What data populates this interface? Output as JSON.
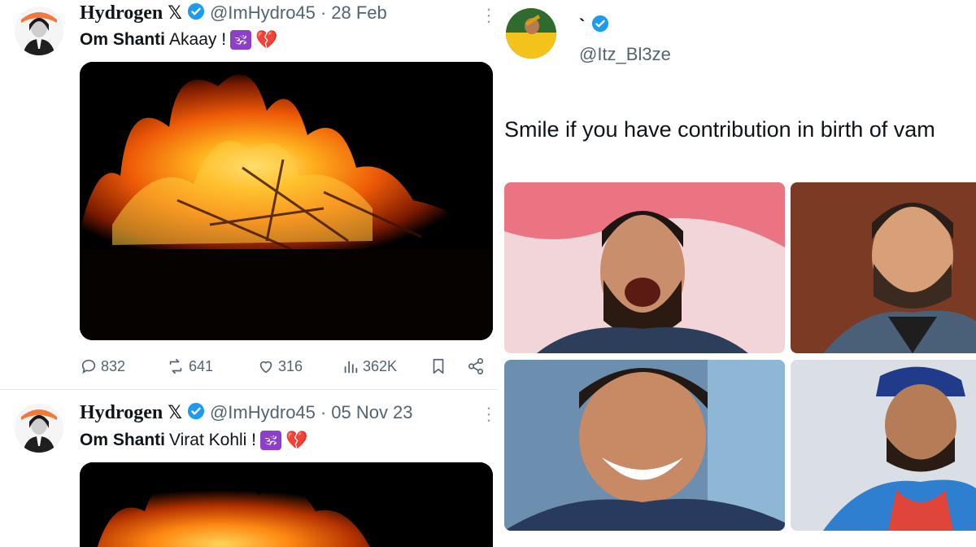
{
  "left_tweets": [
    {
      "name": "Hydrogen",
      "x_badge": "𝕏",
      "handle": "@ImHydro45",
      "separator": "·",
      "date": "28 Feb",
      "text_bold": "Om Shanti",
      "text_rest": "Akaay !",
      "emoji_om": "🕉",
      "emoji_heart": "💔",
      "actions": {
        "replies": "832",
        "reposts": "641",
        "likes": "316",
        "views": "362K"
      }
    },
    {
      "name": "Hydrogen",
      "x_badge": "𝕏",
      "handle": "@ImHydro45",
      "separator": "·",
      "date": "05 Nov 23",
      "text_bold": "Om Shanti",
      "text_rest": "Virat Kohli !",
      "emoji_om": "🕉",
      "emoji_heart": "💔"
    }
  ],
  "right_tweet": {
    "name": "`",
    "handle": "@Itz_Bl3ze",
    "text": "Smile if you have contribution in birth of vam"
  },
  "icons": {
    "verified": "verified-badge-icon",
    "more": "more-options-icon",
    "reply": "reply-icon",
    "repost": "repost-icon",
    "like": "like-icon",
    "views": "views-icon",
    "bookmark": "bookmark-icon",
    "share": "share-icon"
  },
  "colors": {
    "verified_blue": "#1d9bf0",
    "secondary_text": "#536471",
    "fire_orange": "#ff7a00"
  }
}
